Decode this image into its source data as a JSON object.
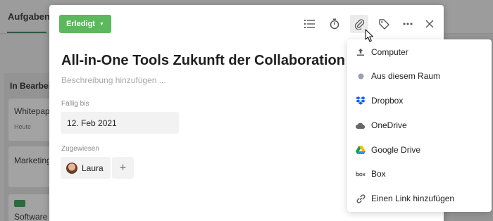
{
  "background": {
    "tab_label": "Aufgaben",
    "column_title": "In Bearbei",
    "cards": [
      {
        "title": "Whitepap",
        "subtitle": "Heute"
      },
      {
        "title": "Marketing",
        "subtitle": ""
      },
      {
        "title": "Software",
        "subtitle": ""
      }
    ]
  },
  "task": {
    "status_label": "Erledigt",
    "title": "All-in-One Tools Zukunft der Collaboration",
    "description_placeholder": "Beschreibung hinzufügen ...",
    "due_label": "Fällig bis",
    "due_value": "12. Feb 2021",
    "assigned_label": "Zugewiesen",
    "assignee_name": "Laura",
    "add_assignee_symbol": "+"
  },
  "toolbar": {
    "icons": [
      "checklist-icon",
      "timer-icon",
      "paperclip-icon",
      "tag-icon",
      "more-icon",
      "close-icon"
    ]
  },
  "attachment_menu": {
    "items": [
      {
        "label": "Computer",
        "icon": "upload-icon"
      },
      {
        "label": "Aus diesem Raum",
        "icon": "dot-icon"
      },
      {
        "label": "Dropbox",
        "icon": "dropbox-icon"
      },
      {
        "label": "OneDrive",
        "icon": "onedrive-icon"
      },
      {
        "label": "Google Drive",
        "icon": "google-drive-icon"
      },
      {
        "label": "Box",
        "icon": "box-icon"
      },
      {
        "label": "Einen Link hinzufügen",
        "icon": "link-icon"
      }
    ]
  },
  "colors": {
    "status_green": "#5cb85c",
    "dropbox_blue": "#0061fe",
    "muted_text": "#a8a8a8"
  }
}
